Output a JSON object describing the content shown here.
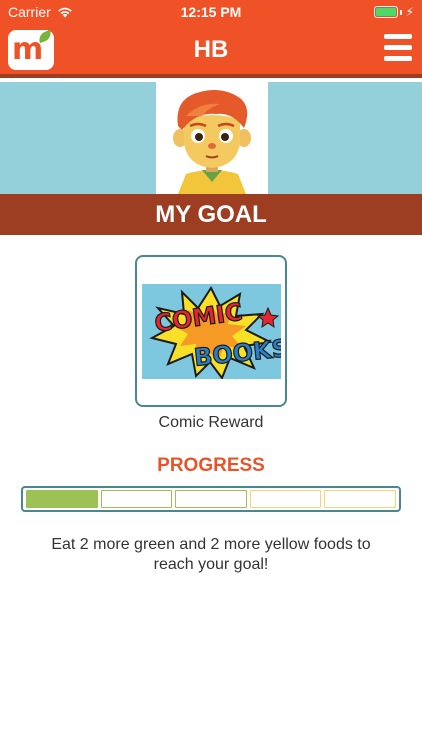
{
  "status_bar": {
    "carrier": "Carrier",
    "time": "12:15 PM",
    "battery_level": 1.0
  },
  "nav": {
    "title": "HB",
    "logo_letter": "m",
    "menu_icon": "hamburger-menu-icon"
  },
  "hero": {
    "avatar": "cartoon-boy-avatar"
  },
  "goal": {
    "heading": "MY GOAL",
    "reward_image_text_1": "COMIC",
    "reward_image_text_2": "BOOKS",
    "reward_label": "Comic Reward"
  },
  "progress": {
    "heading": "PROGRESS",
    "segments": [
      {
        "color": "green",
        "filled": true
      },
      {
        "color": "green",
        "filled": false
      },
      {
        "color": "green",
        "filled": false
      },
      {
        "color": "yellow",
        "filled": false
      },
      {
        "color": "yellow",
        "filled": false
      }
    ],
    "filled_count": 1,
    "total": 5,
    "message": "Eat 2 more green and 2 more yellow foods to reach your goal!"
  },
  "colors": {
    "brand_orange": "#f05228",
    "dark_brown": "#9d3e22",
    "sky_blue": "#94d0d9",
    "teal_border": "#4a878f",
    "green": "#9cc256",
    "yellow": "#f7d27a",
    "progress_heading": "#e8552b"
  }
}
